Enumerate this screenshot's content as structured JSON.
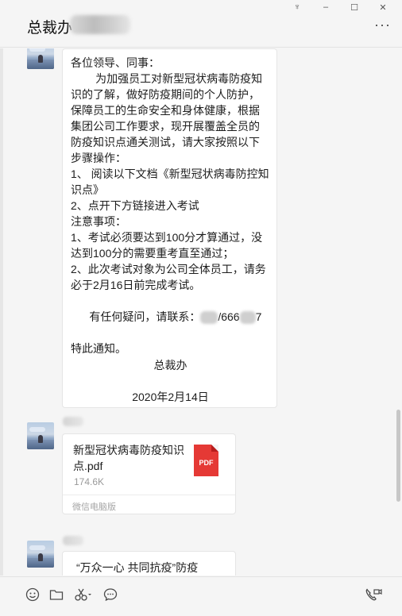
{
  "window": {
    "title": "总裁办",
    "controls": {
      "pin": "♆",
      "minimize": "–",
      "maximize": "☐",
      "close": "✕"
    },
    "more": "···"
  },
  "messages": [
    {
      "type": "text",
      "lines": [
        "各位领导、同事：",
        "        为加强员工对新型冠状病毒防疫知",
        "识的了解，做好防疫期间的个人防护，",
        "保障员工的生命安全和身体健康，根据",
        "集团公司工作要求，现开展覆盖全员的",
        "防疫知识点通关测试，请大家按照以下",
        "步骤操作：",
        "1、 阅读以下文档《新型冠状病毒防控知",
        "识点》",
        "2、点开下方链接进入考试",
        "注意事项：",
        "1、考试必须要达到100分才算通过，没",
        "达到100分的需要重考直至通过；",
        "2、此次考试对象为公司全体员工，请务",
        "必于2月16日前完成考试。"
      ],
      "contact_prefix": "有任何疑问，请联系：",
      "contact_mid": "/666",
      "contact_end": "7",
      "closing": "特此通知。",
      "signature": "总裁办",
      "date": "2020年2月14日"
    },
    {
      "type": "file",
      "file_name": "新型冠状病毒防疫知识点.pdf",
      "file_size": "174.6K",
      "file_type_label": "PDF",
      "source": "微信电脑版"
    },
    {
      "type": "text",
      "preview": "“万众一心 共同抗疫”防疫"
    }
  ],
  "toolbar": {
    "emoji": "☺",
    "folder": "folder",
    "scissors": "✂",
    "chat": "chat",
    "video_call": "video-call"
  }
}
